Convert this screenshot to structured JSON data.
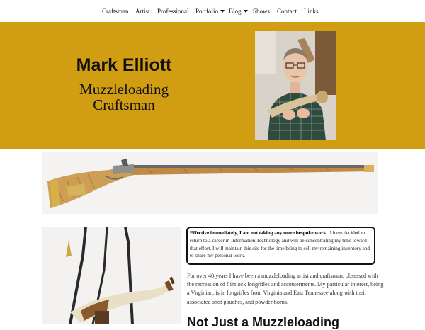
{
  "nav": {
    "items": [
      {
        "label": "Craftsman"
      },
      {
        "label": "Artist"
      },
      {
        "label": "Professional"
      },
      {
        "label": "Portfolio"
      },
      {
        "label": "Blog"
      },
      {
        "label": "Shows"
      },
      {
        "label": "Contact"
      },
      {
        "label": "Links"
      }
    ]
  },
  "hero": {
    "name": "Mark Elliott",
    "subtitle": "Muzzleloading Craftsman",
    "background": "#d19d12"
  },
  "notice": {
    "bold_text": "Effective immediately, I am not taking any more bespoke work.",
    "body_text": "I have decided to return to a career in Information Technology and will be concentrating my time toward that effort.   I will maintain this site for the time being to sell my remaining inventory and to share my personal work."
  },
  "intro": {
    "text": "For over 40 years I have been a muzzleloading artist and craftsman, obsessed with the recreation of flintlock longrifles and accouterments. My particular interest, being a Virginian, is in longrifles from Virginia and East Tennessee along with their associated shot pouches, and powder horns."
  },
  "section": {
    "heading": "Not Just a Muzzleloading"
  }
}
